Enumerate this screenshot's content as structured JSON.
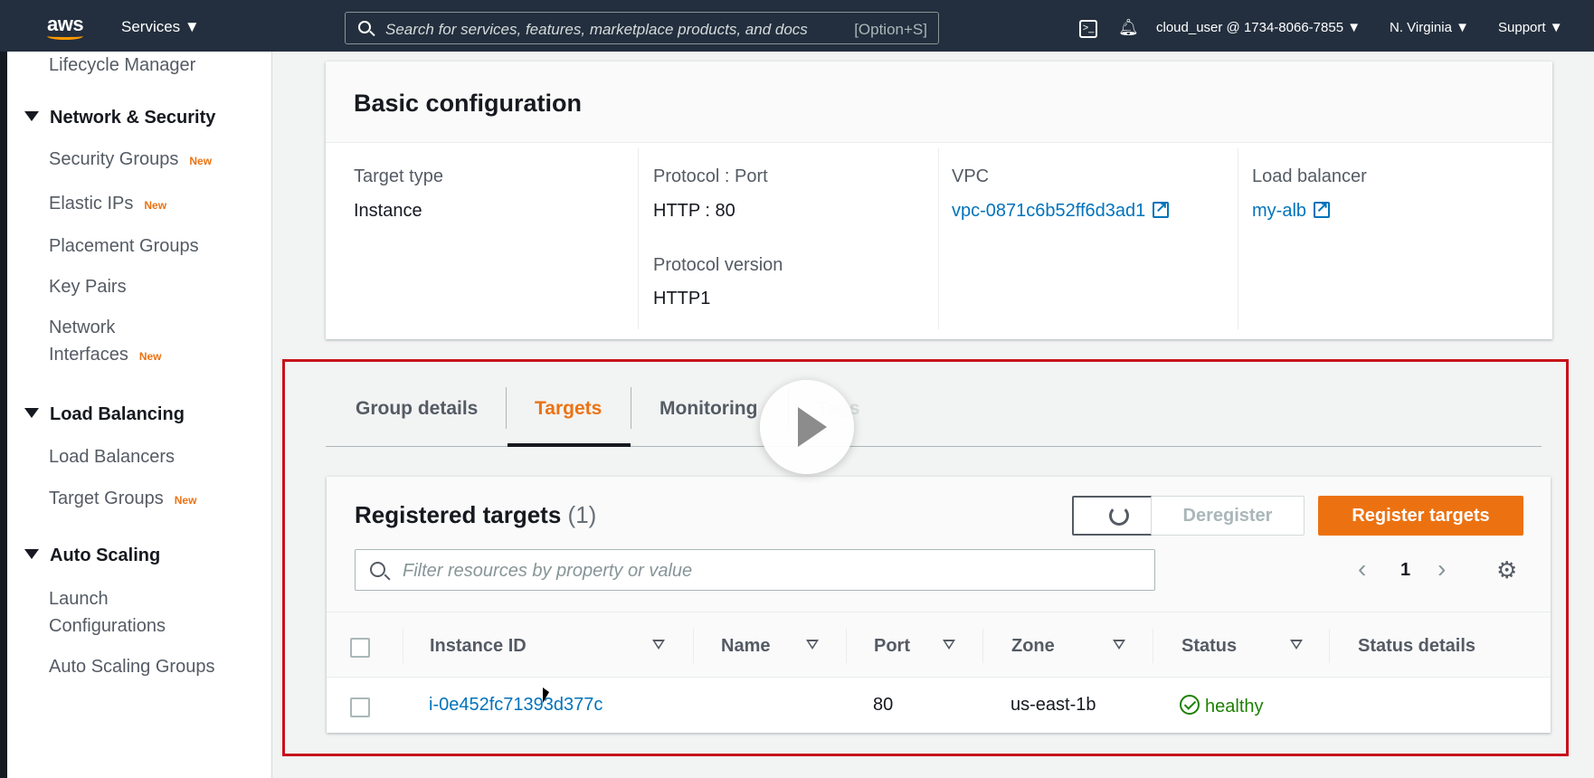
{
  "topnav": {
    "logo": "aws",
    "services": "Services ▼",
    "search_placeholder": "Search for services, features, marketplace products, and docs",
    "search_shortcut": "[Option+S]",
    "cli_icon": "cloudshell-icon",
    "bell_icon": "notifications-icon",
    "account": "cloud_user @ 1734-8066-7855 ▼",
    "region": "N. Virginia ▼",
    "support": "Support ▼"
  },
  "sidebar": {
    "lifecycle": "Lifecycle Manager",
    "network_section": "Network & Security",
    "security_groups": "Security Groups",
    "elastic_ips": "Elastic IPs",
    "placement_groups": "Placement Groups",
    "key_pairs": "Key Pairs",
    "network_interfaces_1": "Network",
    "network_interfaces_2": "Interfaces",
    "lb_section": "Load Balancing",
    "load_balancers": "Load Balancers",
    "target_groups": "Target Groups",
    "as_section": "Auto Scaling",
    "launch_config_1": "Launch",
    "launch_config_2": "Configurations",
    "as_groups": "Auto Scaling Groups",
    "new_badge": "New"
  },
  "basic_config": {
    "title": "Basic configuration",
    "target_type_label": "Target type",
    "target_type_value": "Instance",
    "protocol_port_label": "Protocol : Port",
    "protocol_port_value": "HTTP : 80",
    "protocol_version_label": "Protocol version",
    "protocol_version_value": "HTTP1",
    "vpc_label": "VPC",
    "vpc_value": "vpc-0871c6b52ff6d3ad1",
    "lb_label": "Load balancer",
    "lb_value": "my-alb"
  },
  "tabs": {
    "group_details": "Group details",
    "targets": "Targets",
    "monitoring": "Monitoring",
    "tags": "Tags",
    "active": "Targets"
  },
  "registered": {
    "title": "Registered targets",
    "count": "(1)",
    "deregister": "Deregister",
    "register": "Register targets",
    "filter_placeholder": "Filter resources by property or value",
    "page": "1",
    "columns": [
      "Instance ID",
      "Name",
      "Port",
      "Zone",
      "Status",
      "Status details"
    ],
    "rows": [
      {
        "instance_id": "i-0e452fc71393d377c",
        "name": "",
        "port": "80",
        "zone": "us-east-1b",
        "status": "healthy",
        "status_details": ""
      }
    ]
  },
  "colors": {
    "nav_bg": "#232f3e",
    "accent": "#ec7211",
    "link": "#0073bb",
    "healthy": "#1d8102",
    "highlight": "#c7121a"
  }
}
